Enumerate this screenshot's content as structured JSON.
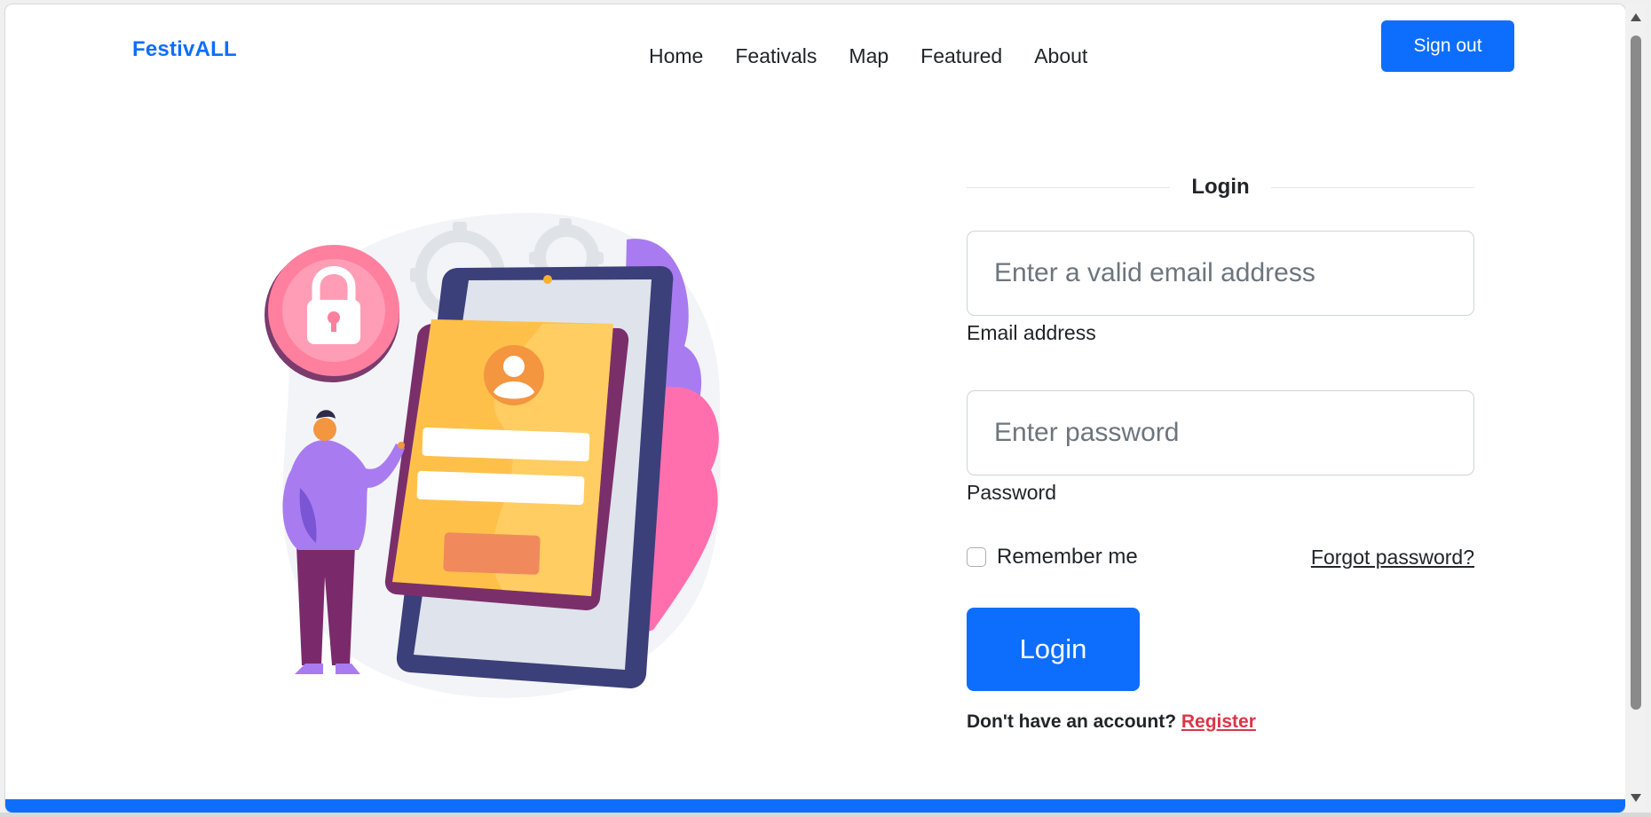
{
  "navbar": {
    "brand": "FestivALL",
    "links": [
      "Home",
      "Feativals",
      "Map",
      "Featured",
      "About"
    ],
    "signout_label": "Sign out"
  },
  "login": {
    "title": "Login",
    "email": {
      "placeholder": "Enter a valid email address",
      "label": "Email address",
      "value": ""
    },
    "password": {
      "placeholder": "Enter password",
      "label": "Password",
      "value": ""
    },
    "remember_label": "Remember me",
    "remember_checked": false,
    "forgot_label": "Forgot password?",
    "submit_label": "Login",
    "register_prompt": "Don't have an account?",
    "register_link": "Register"
  },
  "colors": {
    "primary": "#0d6efd",
    "danger": "#dc3545",
    "text": "#212529"
  },
  "illustration": {
    "icons": [
      "padlock-icon",
      "gear-icon",
      "user-avatar-icon"
    ]
  }
}
